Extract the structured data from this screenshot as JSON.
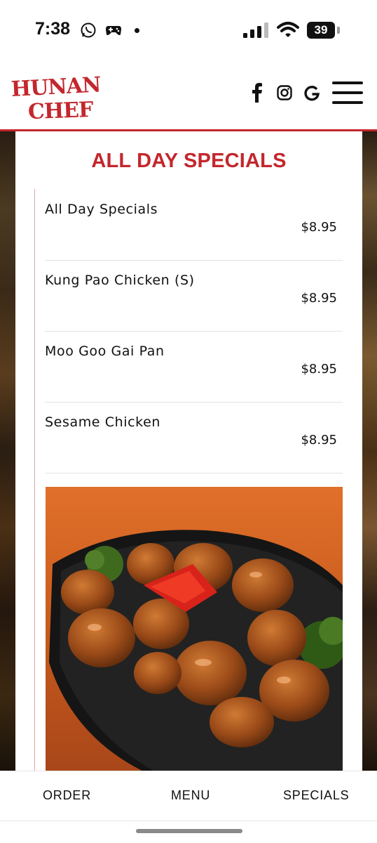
{
  "status_bar": {
    "time": "7:38",
    "battery": "39"
  },
  "brand": {
    "logo_line1": "HUNAN",
    "logo_line2": "CHEF",
    "accent": "#c3272d"
  },
  "header": {
    "social_icons": [
      "facebook-icon",
      "instagram-icon",
      "google-icon"
    ],
    "menu_icon": "hamburger-menu-icon"
  },
  "section": {
    "title": "ALL DAY SPECIALS",
    "items": [
      {
        "name": "All Day Specials",
        "price": "$8.95"
      },
      {
        "name": "Kung Pao Chicken (S)",
        "price": "$8.95"
      },
      {
        "name": "Moo Goo Gai Pan",
        "price": "$8.95"
      },
      {
        "name": "Sesame Chicken",
        "price": "$8.95"
      }
    ]
  },
  "bottom_nav": {
    "order": "ORDER",
    "menu": "MENU",
    "specials": "SPECIALS"
  }
}
